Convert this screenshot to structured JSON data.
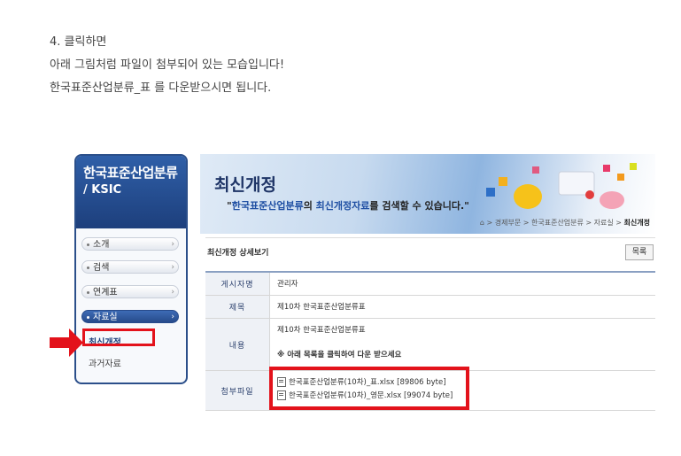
{
  "intro": {
    "line1": "4. 클릭하면",
    "line2": "아래 그림처럼 파일이 첨부되어 있는 모습입니다!",
    "line3": "한국표준산업분류_표  를 다운받으시면 됩니다."
  },
  "nav": {
    "title": "한국표준산업분류",
    "subtitle": "/ KSIC",
    "items": [
      {
        "label": "소개"
      },
      {
        "label": "검색"
      },
      {
        "label": "연계표"
      },
      {
        "label": "자료실"
      }
    ],
    "subitems": [
      {
        "label": "최신개정"
      },
      {
        "label": "과거자료"
      }
    ]
  },
  "banner": {
    "title": "최신개정",
    "desc_quote_open": "\"",
    "desc_hl1": "한국표준산업분류",
    "desc_mid": "의 ",
    "desc_hl2": "최신개정자료",
    "desc_end": "를 검색할 수 있습니다.\"",
    "breadcrumb": "> 경제부문 > 한국표준산업분류 > 자료실 >",
    "breadcrumb_current": "최신개정"
  },
  "detail": {
    "heading": "최신개정 상세보기",
    "list_button": "목록",
    "rows": {
      "author_label": "게시자명",
      "author_value": "관리자",
      "title_label": "제목",
      "title_value": "제10차 한국표준산업분류표",
      "content_label": "내용",
      "content_value": "제10차 한국표준산업분류표",
      "content_note": "※ 아래 목록을 클릭하여 다운 받으세요",
      "attach_label": "첨부파일",
      "files": [
        "한국표준산업분류(10차)_표.xlsx [89806 byte]",
        "한국표준산업분류(10차)_영문.xlsx [99074 byte]"
      ]
    }
  }
}
